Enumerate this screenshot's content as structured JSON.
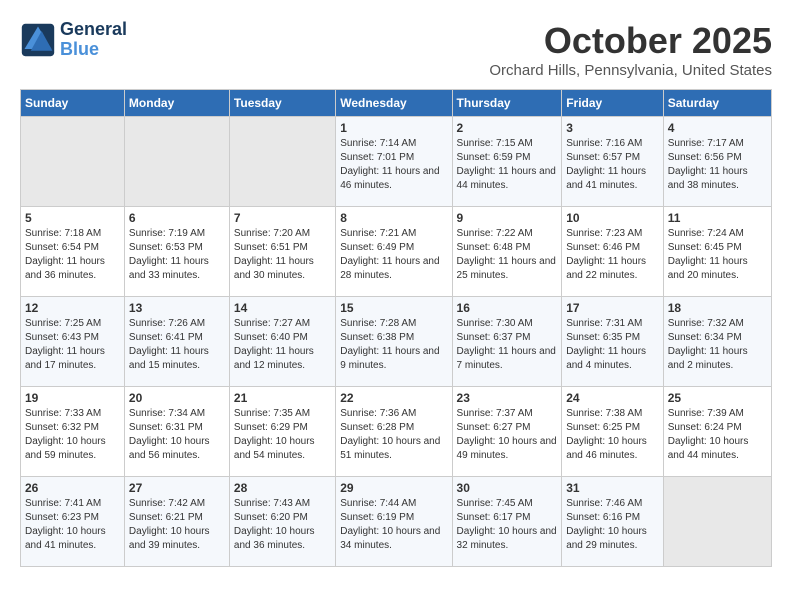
{
  "logo": {
    "line1": "General",
    "line2": "Blue"
  },
  "title": "October 2025",
  "subtitle": "Orchard Hills, Pennsylvania, United States",
  "weekdays": [
    "Sunday",
    "Monday",
    "Tuesday",
    "Wednesday",
    "Thursday",
    "Friday",
    "Saturday"
  ],
  "weeks": [
    [
      {
        "day": "",
        "info": ""
      },
      {
        "day": "",
        "info": ""
      },
      {
        "day": "",
        "info": ""
      },
      {
        "day": "1",
        "info": "Sunrise: 7:14 AM\nSunset: 7:01 PM\nDaylight: 11 hours and 46 minutes."
      },
      {
        "day": "2",
        "info": "Sunrise: 7:15 AM\nSunset: 6:59 PM\nDaylight: 11 hours and 44 minutes."
      },
      {
        "day": "3",
        "info": "Sunrise: 7:16 AM\nSunset: 6:57 PM\nDaylight: 11 hours and 41 minutes."
      },
      {
        "day": "4",
        "info": "Sunrise: 7:17 AM\nSunset: 6:56 PM\nDaylight: 11 hours and 38 minutes."
      }
    ],
    [
      {
        "day": "5",
        "info": "Sunrise: 7:18 AM\nSunset: 6:54 PM\nDaylight: 11 hours and 36 minutes."
      },
      {
        "day": "6",
        "info": "Sunrise: 7:19 AM\nSunset: 6:53 PM\nDaylight: 11 hours and 33 minutes."
      },
      {
        "day": "7",
        "info": "Sunrise: 7:20 AM\nSunset: 6:51 PM\nDaylight: 11 hours and 30 minutes."
      },
      {
        "day": "8",
        "info": "Sunrise: 7:21 AM\nSunset: 6:49 PM\nDaylight: 11 hours and 28 minutes."
      },
      {
        "day": "9",
        "info": "Sunrise: 7:22 AM\nSunset: 6:48 PM\nDaylight: 11 hours and 25 minutes."
      },
      {
        "day": "10",
        "info": "Sunrise: 7:23 AM\nSunset: 6:46 PM\nDaylight: 11 hours and 22 minutes."
      },
      {
        "day": "11",
        "info": "Sunrise: 7:24 AM\nSunset: 6:45 PM\nDaylight: 11 hours and 20 minutes."
      }
    ],
    [
      {
        "day": "12",
        "info": "Sunrise: 7:25 AM\nSunset: 6:43 PM\nDaylight: 11 hours and 17 minutes."
      },
      {
        "day": "13",
        "info": "Sunrise: 7:26 AM\nSunset: 6:41 PM\nDaylight: 11 hours and 15 minutes."
      },
      {
        "day": "14",
        "info": "Sunrise: 7:27 AM\nSunset: 6:40 PM\nDaylight: 11 hours and 12 minutes."
      },
      {
        "day": "15",
        "info": "Sunrise: 7:28 AM\nSunset: 6:38 PM\nDaylight: 11 hours and 9 minutes."
      },
      {
        "day": "16",
        "info": "Sunrise: 7:30 AM\nSunset: 6:37 PM\nDaylight: 11 hours and 7 minutes."
      },
      {
        "day": "17",
        "info": "Sunrise: 7:31 AM\nSunset: 6:35 PM\nDaylight: 11 hours and 4 minutes."
      },
      {
        "day": "18",
        "info": "Sunrise: 7:32 AM\nSunset: 6:34 PM\nDaylight: 11 hours and 2 minutes."
      }
    ],
    [
      {
        "day": "19",
        "info": "Sunrise: 7:33 AM\nSunset: 6:32 PM\nDaylight: 10 hours and 59 minutes."
      },
      {
        "day": "20",
        "info": "Sunrise: 7:34 AM\nSunset: 6:31 PM\nDaylight: 10 hours and 56 minutes."
      },
      {
        "day": "21",
        "info": "Sunrise: 7:35 AM\nSunset: 6:29 PM\nDaylight: 10 hours and 54 minutes."
      },
      {
        "day": "22",
        "info": "Sunrise: 7:36 AM\nSunset: 6:28 PM\nDaylight: 10 hours and 51 minutes."
      },
      {
        "day": "23",
        "info": "Sunrise: 7:37 AM\nSunset: 6:27 PM\nDaylight: 10 hours and 49 minutes."
      },
      {
        "day": "24",
        "info": "Sunrise: 7:38 AM\nSunset: 6:25 PM\nDaylight: 10 hours and 46 minutes."
      },
      {
        "day": "25",
        "info": "Sunrise: 7:39 AM\nSunset: 6:24 PM\nDaylight: 10 hours and 44 minutes."
      }
    ],
    [
      {
        "day": "26",
        "info": "Sunrise: 7:41 AM\nSunset: 6:23 PM\nDaylight: 10 hours and 41 minutes."
      },
      {
        "day": "27",
        "info": "Sunrise: 7:42 AM\nSunset: 6:21 PM\nDaylight: 10 hours and 39 minutes."
      },
      {
        "day": "28",
        "info": "Sunrise: 7:43 AM\nSunset: 6:20 PM\nDaylight: 10 hours and 36 minutes."
      },
      {
        "day": "29",
        "info": "Sunrise: 7:44 AM\nSunset: 6:19 PM\nDaylight: 10 hours and 34 minutes."
      },
      {
        "day": "30",
        "info": "Sunrise: 7:45 AM\nSunset: 6:17 PM\nDaylight: 10 hours and 32 minutes."
      },
      {
        "day": "31",
        "info": "Sunrise: 7:46 AM\nSunset: 6:16 PM\nDaylight: 10 hours and 29 minutes."
      },
      {
        "day": "",
        "info": ""
      }
    ]
  ]
}
